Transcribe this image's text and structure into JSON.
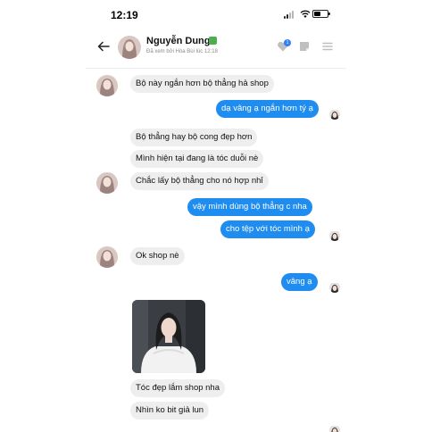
{
  "status_bar": {
    "time": "12:19"
  },
  "header": {
    "contact_name": "Nguyễn Dung",
    "seen_text": "Đã xem bởi Hòa Bùi lúc 12:18",
    "notification_count": "1"
  },
  "messages": [
    {
      "text": "Bộ này ngắn hơn bộ thẳng hả shop"
    },
    {
      "text": "dạ vâng ạ ngắn hơn tý ạ"
    },
    {
      "text": "Bộ thẳng hay bộ cong đẹp hơn"
    },
    {
      "text": "Mình hiện tại đang là tóc duỗi nè"
    },
    {
      "text": "Chắc lấy bộ thẳng cho nó hợp nhỉ"
    },
    {
      "text": "vậy mình dùng bộ thẳng c nha"
    },
    {
      "text": "cho tệp với tóc mình ạ"
    },
    {
      "text": "Ok shop nè"
    },
    {
      "text": "vâng ạ"
    },
    {
      "text": "Tóc đẹp lắm shop nha"
    },
    {
      "text": "Nhìn ko bit giả lun"
    }
  ],
  "colors": {
    "outgoing_bubble": "#1f8cf0",
    "incoming_bubble": "#eeeeee"
  }
}
